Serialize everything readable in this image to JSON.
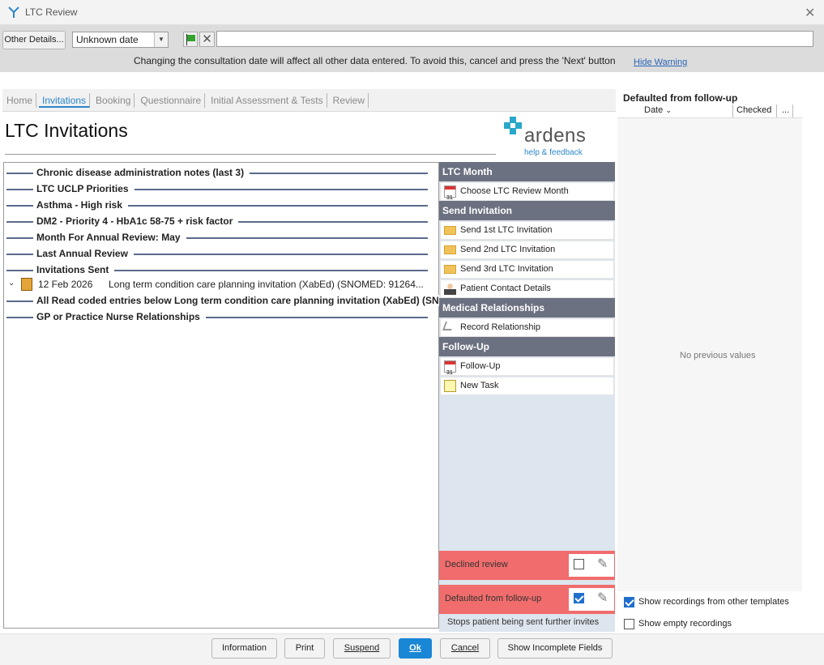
{
  "window": {
    "title": "LTC Review"
  },
  "toolbar": {
    "other_details_label": "Other Details...",
    "date_value": "Unknown date",
    "consultation_input_value": "",
    "warning_text": "Changing the consultation date will affect all other data entered. To avoid this, cancel and press the 'Next' button",
    "hide_warning_label": "Hide Warning"
  },
  "tabs": [
    {
      "label": "Home",
      "active": false
    },
    {
      "label": "Invitations",
      "active": true
    },
    {
      "label": "Booking",
      "active": false
    },
    {
      "label": "Questionnaire",
      "active": false
    },
    {
      "label": "Initial Assessment & Tests",
      "active": false
    },
    {
      "label": "Review",
      "active": false
    }
  ],
  "page": {
    "title": "LTC Invitations",
    "logo_text": "ardens",
    "logo_sub": "help & feedback"
  },
  "sections": [
    {
      "label": "Chronic disease administration notes (last 3)"
    },
    {
      "label": "LTC UCLP Priorities"
    },
    {
      "label": "Asthma - High risk"
    },
    {
      "label": "DM2 - Priority 4 - HbA1c 58-75 + risk factor"
    },
    {
      "label": "Month For Annual Review: May"
    },
    {
      "label": "Last Annual Review"
    },
    {
      "label": "Invitations Sent"
    }
  ],
  "invitation_entry": {
    "date": "12 Feb 2026",
    "text": "Long term condition care planning invitation (XabEd) (SNOMED: 91264..."
  },
  "sections_after": [
    {
      "label": "All Read coded entries below Long term condition care planning invitation (XabEd) (SNO"
    },
    {
      "label": "GP or Practice Nurse Relationships"
    }
  ],
  "side_panel": {
    "headers": {
      "ltc_month": "LTC Month",
      "send_invitation": "Send Invitation",
      "medical_relationships": "Medical Relationships",
      "follow_up": "Follow-Up"
    },
    "items": {
      "choose_month": "Choose LTC Review Month",
      "send_1st": "Send 1st LTC Invitation",
      "send_2nd": "Send 2nd LTC Invitation",
      "send_3rd": "Send 3rd LTC Invitation",
      "patient_contact": "Patient Contact Details",
      "record_relationship": "Record Relationship",
      "follow_up": "Follow-Up",
      "new_task": "New Task"
    },
    "declined_review": {
      "label": "Declined review",
      "checked": false
    },
    "defaulted": {
      "label": "Defaulted from follow-up",
      "checked": true
    },
    "stops_note": "Stops patient being sent further invites",
    "calendar_icon_text": "31"
  },
  "right_panel": {
    "title": "Defaulted from follow-up",
    "columns": [
      "Date",
      "Checked",
      "..."
    ],
    "empty_text": "No previous values",
    "show_other_templates": {
      "label": "Show recordings from other templates",
      "checked": true
    },
    "show_empty": {
      "label": "Show empty recordings",
      "checked": false
    }
  },
  "buttons": {
    "information": "Information",
    "print": "Print",
    "suspend": "Suspend",
    "ok": "Ok",
    "cancel": "Cancel",
    "show_incomplete": "Show Incomplete Fields"
  },
  "colors": {
    "accent": "#2c86c8",
    "side_header": "#6b7180",
    "alert_red": "#f16c6c",
    "primary_button": "#1a86d6"
  }
}
